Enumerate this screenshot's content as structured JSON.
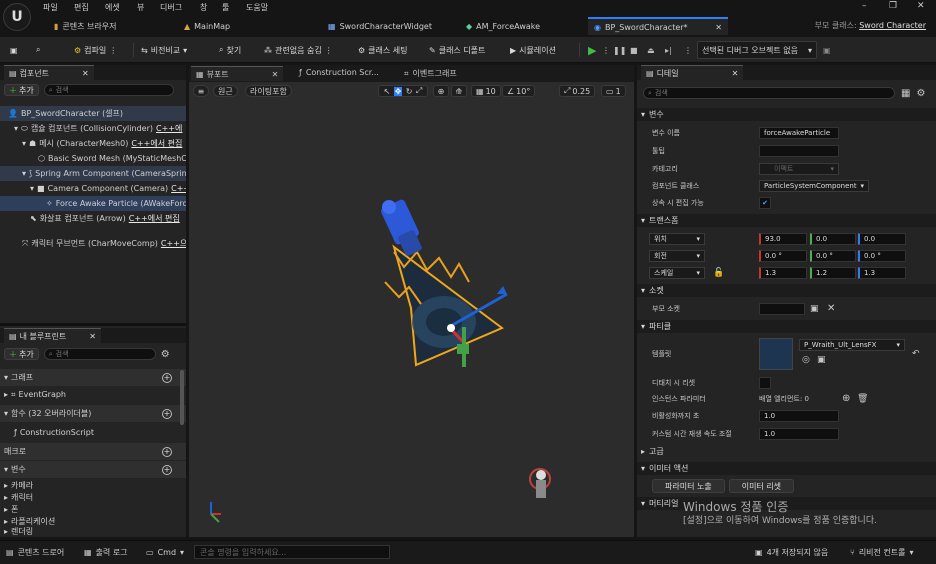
{
  "menu": {
    "items": [
      "파일",
      "편집",
      "에셋",
      "뷰",
      "디버그",
      "창",
      "툴",
      "도움말"
    ]
  },
  "tabs": [
    {
      "label": "콘텐츠 브라우저",
      "active": false
    },
    {
      "label": "MainMap",
      "active": false
    },
    {
      "label": "SwordCharacterWidget",
      "active": false
    },
    {
      "label": "AM_ForceAwake",
      "active": false
    },
    {
      "label": "BP_SwordCharacter*",
      "active": true
    }
  ],
  "parent_class": {
    "label": "부모 클래스:",
    "value": "Sword Character"
  },
  "toolbar": {
    "compile": "컴파일",
    "diff": "비전비교",
    "find": "찾기",
    "hide_unrelated": "관련없음 숨김",
    "class_settings": "클래스 세팅",
    "class_defaults": "클래스 디폴트",
    "simulation": "시뮬레이션",
    "debug_object": "선택된 디버그 오브젝트 없음"
  },
  "components": {
    "title": "컴포넌트",
    "add": "추가",
    "search_placeholder": "검색",
    "items": [
      {
        "label": "BP_SwordCharacter (셀프)",
        "extra": ""
      },
      {
        "label": "캡슐 컴포넌트 (CollisionCylinder)",
        "extra": "C++에"
      },
      {
        "label": "메시 (CharacterMesh0)",
        "extra": "C++에서 편집"
      },
      {
        "label": "Basic Sword Mesh (MyStaticMeshC",
        "extra": ""
      },
      {
        "label": "Spring Arm Component (CameraSprin",
        "extra": ""
      },
      {
        "label": "Camera Component (Camera)",
        "extra": "C++으"
      },
      {
        "label": "Force Awake Particle (AWakeForc",
        "extra": ""
      },
      {
        "label": "화살표 컴포넌트 (Arrow)",
        "extra": "C++에서 편집"
      },
      {
        "label": "캐릭터 무브먼트 (CharMoveComp)",
        "extra": "C++으"
      }
    ]
  },
  "blueprint": {
    "title": "내 블루프린트",
    "add": "추가",
    "search_placeholder": "검색",
    "graph_section": "그래프",
    "event_graph": "EventGraph",
    "functions_section": "함수 (32 오버라이더블)",
    "construction_script": "ConstructionScript",
    "macros_section": "매크로",
    "variables_section": "변수",
    "var_categories": [
      "카메라",
      "캐릭터",
      "폰",
      "라플리케이션",
      "렌더링"
    ]
  },
  "viewport": {
    "tabs": [
      "뷰포트",
      "Construction Scr...",
      "이벤트그래프"
    ],
    "perspective": "원근",
    "lighting": "라이팅포함",
    "grid_snap": "10",
    "rot_snap": "10°",
    "scale_snap": "0.25",
    "camera_speed": "1"
  },
  "details": {
    "title": "디테일",
    "search_placeholder": "검색",
    "sections": {
      "variable": "변수",
      "transform": "트랜스폼",
      "sockets": "소켓",
      "particles": "파티클",
      "advanced": "고급",
      "emitter_actions": "이미터 액션",
      "materials": "머티리얼"
    },
    "variable_name": {
      "label": "변수 이름",
      "value": "forceAwakeParticle"
    },
    "tooltip": {
      "label": "툴팁",
      "value": ""
    },
    "category": {
      "label": "카테고리",
      "value": "이펙트"
    },
    "component_class": {
      "label": "컴포넌트 클래스",
      "value": "ParticleSystemComponent"
    },
    "editable_inherit": {
      "label": "상속 시 편집 가능"
    },
    "location": {
      "label": "위치",
      "x": "93.0",
      "y": "0.0",
      "z": "0.0"
    },
    "rotation": {
      "label": "회전",
      "x": "0.0 °",
      "y": "0.0 °",
      "z": "0.0 °"
    },
    "scale": {
      "label": "스케일",
      "x": "1.3",
      "y": "1.2",
      "z": "1.3"
    },
    "parent_socket": {
      "label": "부모 소켓",
      "value": ""
    },
    "template": {
      "label": "템플릿",
      "value": "P_Wraith_Ult_LensFX"
    },
    "kill_on_deactivate": {
      "label": "디태치 시 리셋"
    },
    "instance_params": {
      "label": "인스턴스 파라미터",
      "value": "배열 엘리먼트: 0"
    },
    "seconds_before_inactive": {
      "label": "비활성화까지 초",
      "value": "1.0"
    },
    "custom_time_dilation": {
      "label": "커스텀 시간 재생 속도 조절",
      "value": "1.0"
    },
    "emitter_buttons": [
      "파라미터 노출",
      "이미터 리셋"
    ]
  },
  "statusbar": {
    "content_drawer": "콘텐츠 드로어",
    "output_log": "출력 로그",
    "cmd": "Cmd",
    "console_placeholder": "콘솔 명령을 입력하세요...",
    "unsaved": "4개 저장되지 않음",
    "revision_control": "리비전 컨트롤"
  },
  "watermark": {
    "line1": "Windows 정품 인증",
    "line2": "[설정]으로 이동하여 Windows를 정품 인증합니다."
  },
  "colors": {
    "accent": "#2a7fff",
    "selection": "#2e3f5c",
    "play": "#3fbf3f",
    "gizmo_x": "#d32f2f",
    "gizmo_y": "#43a047",
    "gizmo_z": "#1e63d6",
    "particle": "#e0a020"
  }
}
